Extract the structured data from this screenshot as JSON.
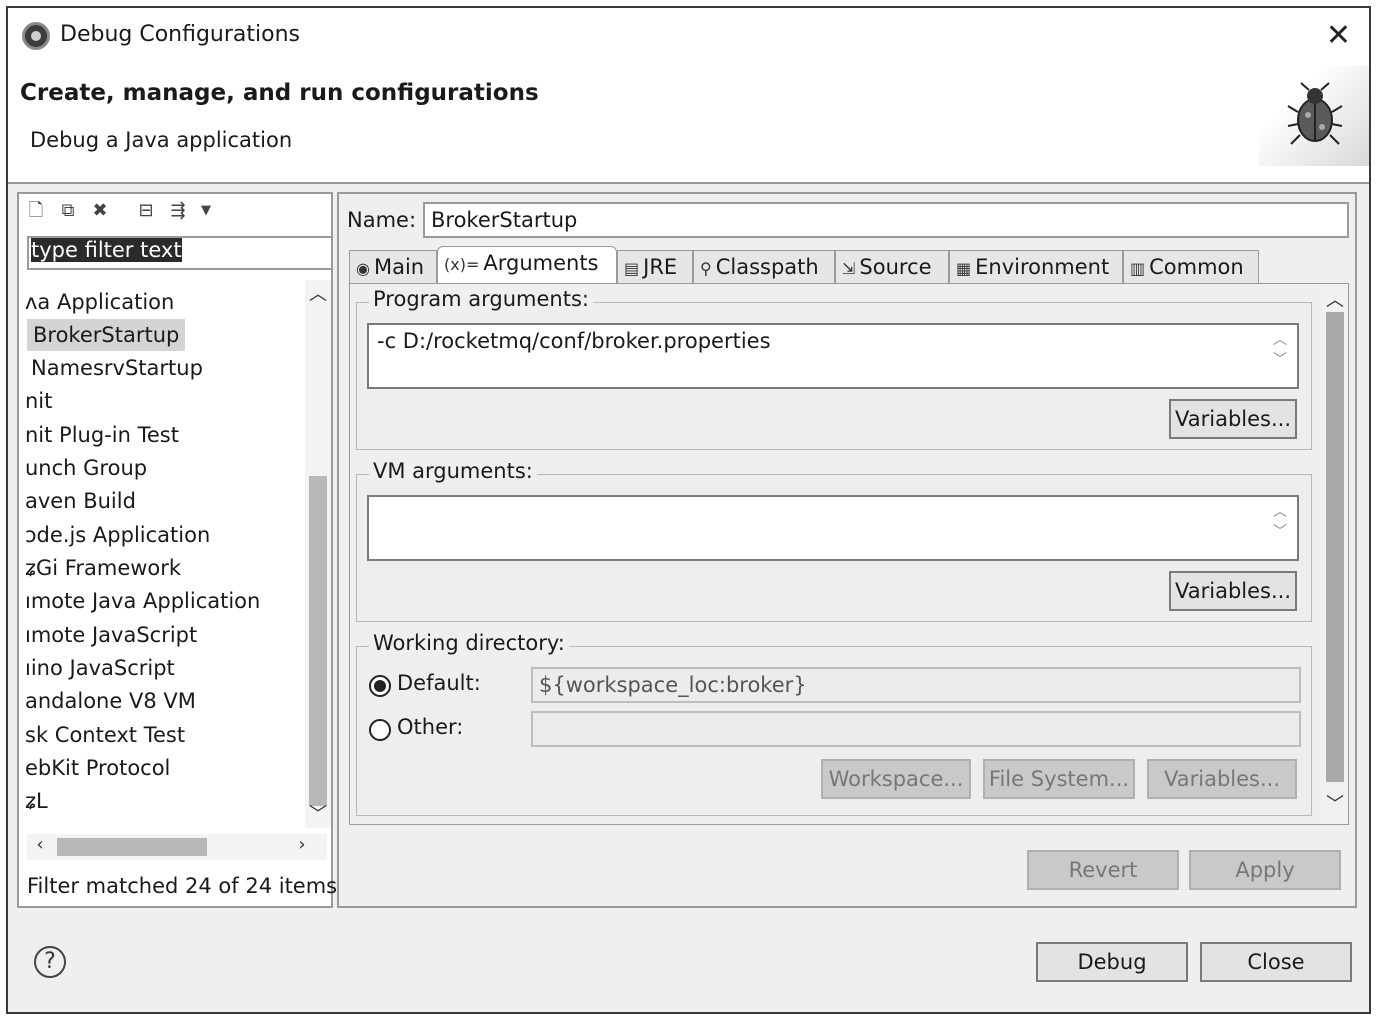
{
  "window": {
    "title": "Debug Configurations"
  },
  "banner": {
    "title": "Create, manage, and run configurations",
    "subtitle": "Debug a Java application"
  },
  "left": {
    "filter_placeholder": "type filter text",
    "tree": [
      "ʌa Application",
      "BrokerStartup",
      "NamesrvStartup",
      "nit",
      "nit Plug-in Test",
      "unch Group",
      "aven Build",
      "ɔde.js Application",
      "ʑGi Framework",
      "ımote Java Application",
      "ımote JavaScript",
      "ıino JavaScript",
      "andalone V8 VM",
      "sk Context Test",
      "ebKit Protocol",
      "ʑL"
    ],
    "status": "Filter matched 24 of 24 items"
  },
  "right": {
    "name_label": "Name:",
    "name_value": "BrokerStartup",
    "tabs": [
      {
        "label": "Main",
        "icon": "main-tab-icon"
      },
      {
        "label": "Arguments",
        "icon": "arguments-tab-icon"
      },
      {
        "label": "JRE",
        "icon": "jre-tab-icon"
      },
      {
        "label": "Classpath",
        "icon": "classpath-tab-icon"
      },
      {
        "label": "Source",
        "icon": "source-tab-icon"
      },
      {
        "label": "Environment",
        "icon": "environment-tab-icon"
      },
      {
        "label": "Common",
        "icon": "common-tab-icon"
      }
    ],
    "program_args": {
      "label": "Program arguments:",
      "value": "-c D:/rocketmq/conf/broker.properties",
      "variables_btn": "Variables..."
    },
    "vm_args": {
      "label": "VM arguments:",
      "value": "",
      "variables_btn": "Variables..."
    },
    "working_dir": {
      "label": "Working directory:",
      "default_label": "Default:",
      "default_value": "${workspace_loc:broker}",
      "other_label": "Other:",
      "other_value": "",
      "workspace_btn": "Workspace...",
      "filesystem_btn": "File System...",
      "variables_btn": "Variables..."
    },
    "revert_btn": "Revert",
    "apply_btn": "Apply"
  },
  "footer": {
    "help": "?",
    "debug_btn": "Debug",
    "close_btn": "Close"
  }
}
